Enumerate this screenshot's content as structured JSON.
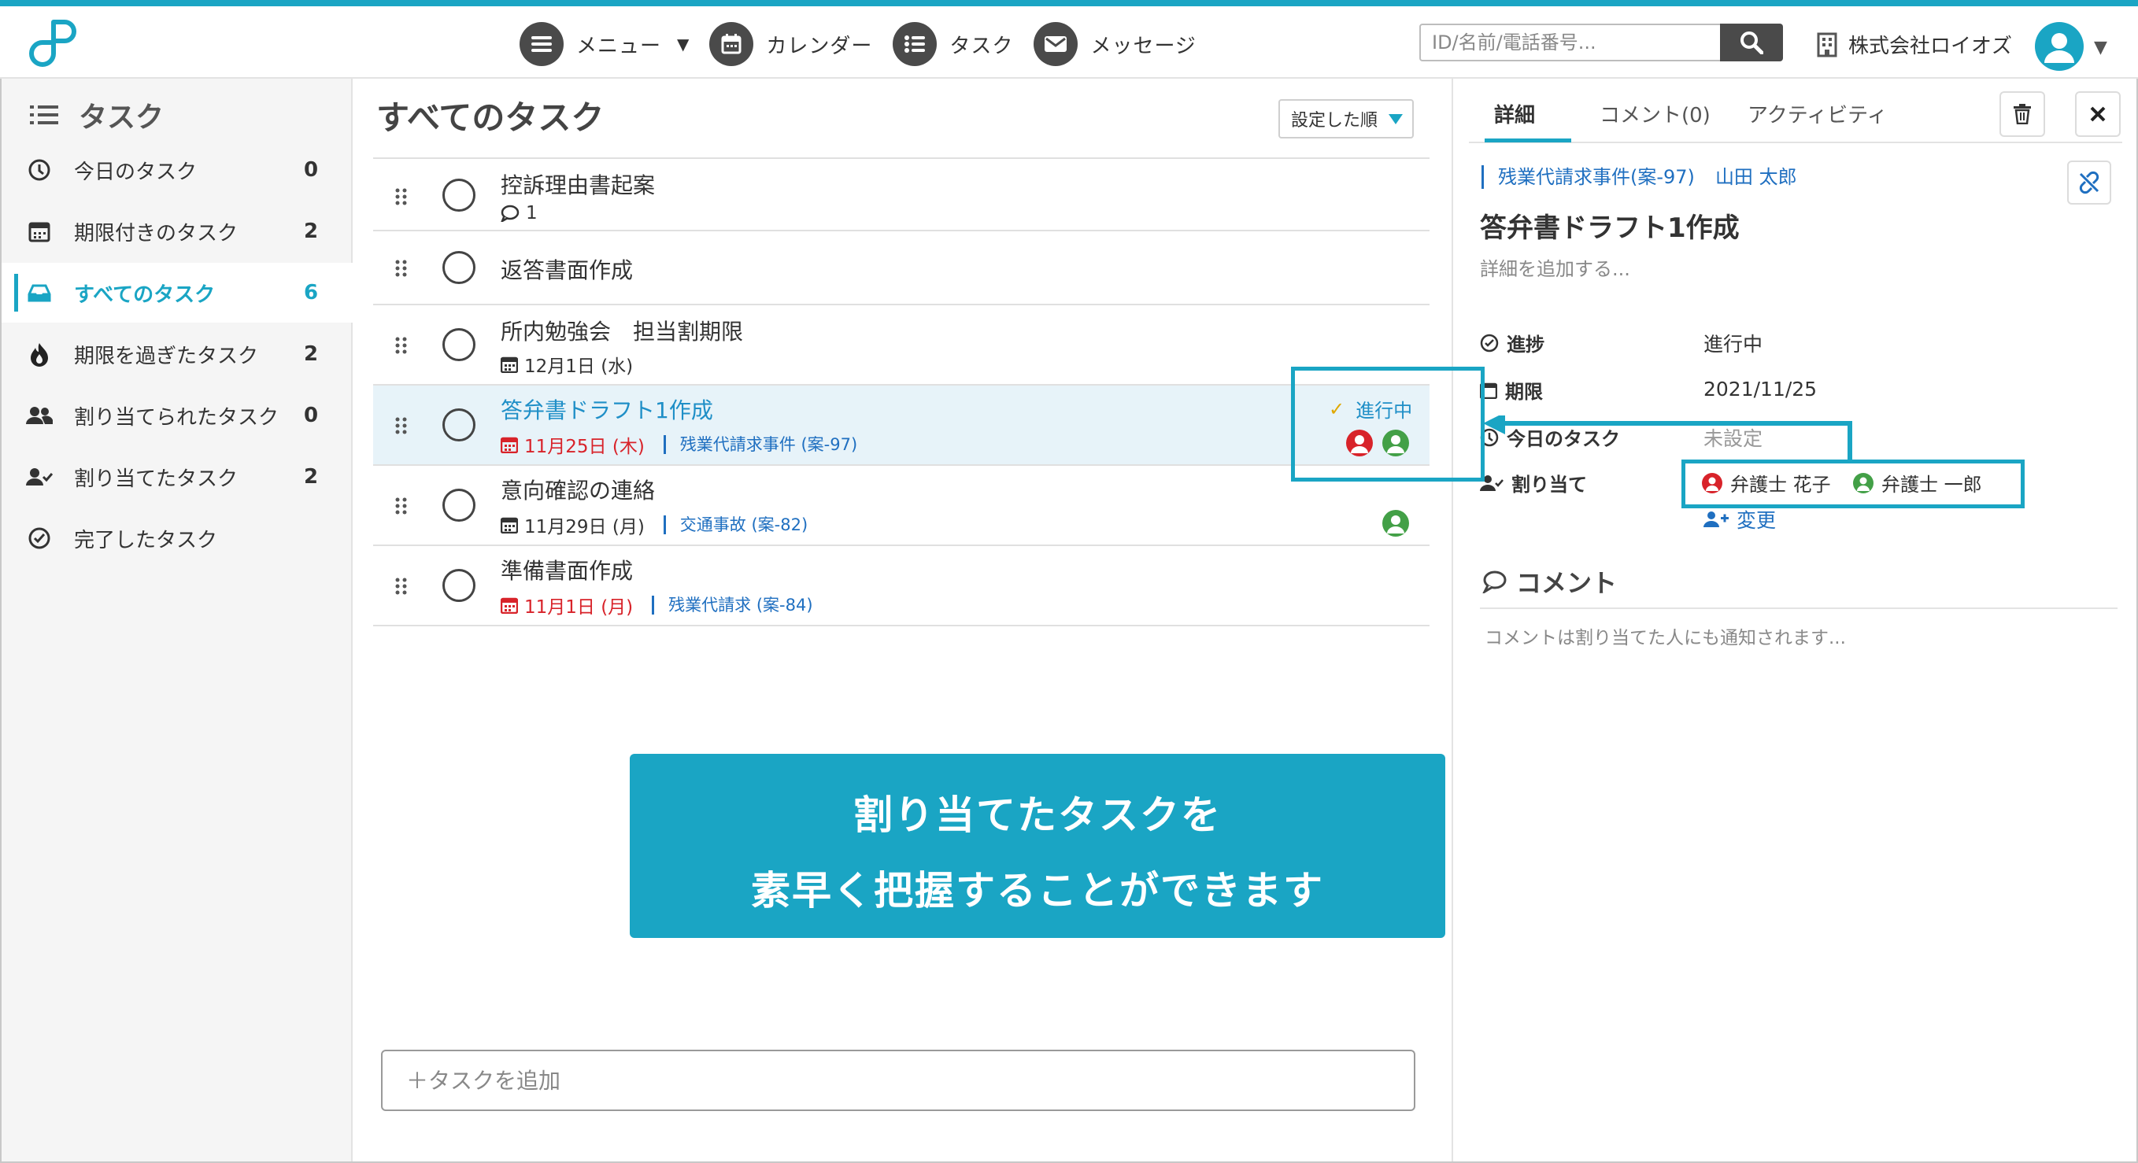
{
  "header": {
    "nav": [
      {
        "label": "メニュー",
        "icon": "menu-icon"
      },
      {
        "label": "カレンダー",
        "icon": "calendar-icon"
      },
      {
        "label": "タスク",
        "icon": "list-icon"
      },
      {
        "label": "メッセージ",
        "icon": "mail-icon"
      }
    ],
    "search_placeholder": "ID/名前/電話番号...",
    "company": "株式会社ロイオズ"
  },
  "sidebar": {
    "title": "タスク",
    "items": [
      {
        "label": "今日のタスク",
        "count": "0",
        "icon": "clock-icon"
      },
      {
        "label": "期限付きのタスク",
        "count": "2",
        "icon": "calendar-icon"
      },
      {
        "label": "すべてのタスク",
        "count": "6",
        "icon": "inbox-icon",
        "active": true
      },
      {
        "label": "期限を過ぎたタスク",
        "count": "2",
        "icon": "fire-icon"
      },
      {
        "label": "割り当てられたタスク",
        "count": "0",
        "icon": "users-icon"
      },
      {
        "label": "割り当てたタスク",
        "count": "2",
        "icon": "user-check-icon"
      },
      {
        "label": "完了したタスク",
        "count": "",
        "icon": "check-circle-icon"
      }
    ]
  },
  "main": {
    "title": "すべてのタスク",
    "sort_label": "設定した順",
    "add_placeholder": "＋タスクを追加",
    "tasks": [
      {
        "title": "控訴理由書起案",
        "comments": "1"
      },
      {
        "title": "返答書面作成"
      },
      {
        "title": "所内勉強会　担当割期限",
        "date": "12月1日 (水)"
      },
      {
        "title": "答弁書ドラフト1作成",
        "date": "11月25日 (木)",
        "case": "残業代請求事件 (案-97)",
        "status": "進行中",
        "overdue": true,
        "selected": true
      },
      {
        "title": "意向確認の連絡",
        "date": "11月29日 (月)",
        "case": "交通事故 (案-82)"
      },
      {
        "title": "準備書面作成",
        "date": "11月1日 (月)",
        "case": "残業代請求 (案-84)",
        "overdue": true
      }
    ]
  },
  "banner": {
    "line1": "割り当てたタスクを",
    "line2": "素早く把握することができます"
  },
  "detail": {
    "tabs": [
      "詳細",
      "コメント(0)",
      "アクティビティ"
    ],
    "breadcrumb_case": "残業代請求事件(案-97)",
    "breadcrumb_client": "山田 太郎",
    "title": "答弁書ドラフト1作成",
    "description_placeholder": "詳細を追加する...",
    "props": {
      "progress_label": "進捗",
      "progress_value": "進行中",
      "due_label": "期限",
      "due_value": "2021/11/25",
      "today_label": "今日のタスク",
      "today_value": "未設定",
      "assign_label": "割り当て"
    },
    "assignees": [
      "弁護士 花子",
      "弁護士 一郎"
    ],
    "change_label": "変更",
    "comment_title": "コメント",
    "comment_placeholder": "コメントは割り当てた人にも通知されます..."
  },
  "colors": {
    "accent": "#1aa5c4",
    "overdue": "#d8232a",
    "link": "#1f6fc0",
    "assignee_a": "#d8232a",
    "assignee_b": "#43a047"
  }
}
